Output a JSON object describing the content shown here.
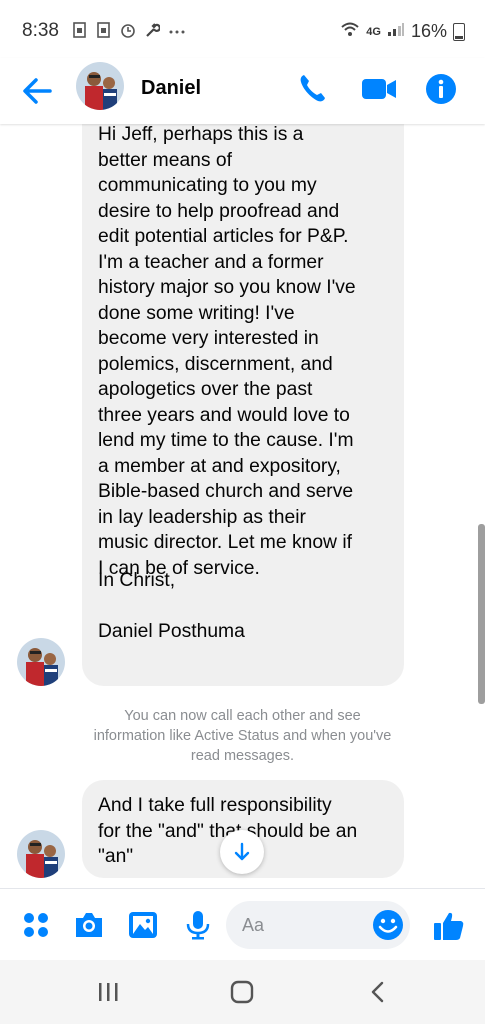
{
  "status_bar": {
    "time": "8:38",
    "network": "4G",
    "battery": "16%",
    "notification_icons": [
      "sim-icon",
      "sim-icon",
      "alarm-icon",
      "wrench-icon",
      "more-icon"
    ]
  },
  "header": {
    "contact_name": "Daniel",
    "buttons": [
      "back-arrow-icon",
      "phone-icon",
      "video-camera-icon",
      "info-icon"
    ]
  },
  "thread": {
    "message_1": {
      "body": "Hi Jeff, perhaps this is a\nbetter means of\ncommunicating to you my\ndesire to help proofread and\nedit potential articles for P&P.\nI'm a teacher and a former\nhistory major so you know I've\ndone some writing! I've\nbecome very interested in\npolemics, discernment, and\napologetics over the past\nthree years and would love to\nlend my time to the cause. I'm\na member at and expository,\nBible-based church and serve\nin lay leadership as their\nmusic director. Let me know if\nI can be of service.",
      "closing": "In Christ,",
      "signature": "Daniel Posthuma"
    },
    "notice": "You can now call each other and see information like Active Status and when you've read messages.",
    "message_2": {
      "body": "And I take full responsibility\nfor the \"and\" that should be an\n\"an\""
    }
  },
  "composer": {
    "placeholder": "Aa",
    "buttons": [
      "apps-icon",
      "camera-icon",
      "photo-icon",
      "microphone-icon",
      "emoji-icon",
      "thumbs-up-icon"
    ]
  },
  "nav_bar": {
    "buttons": [
      "recent-apps-icon",
      "home-icon",
      "back-icon"
    ]
  },
  "colors": {
    "accent": "#0084ff",
    "bubble": "#f0f0f0",
    "notice_text": "#8a8d91"
  }
}
